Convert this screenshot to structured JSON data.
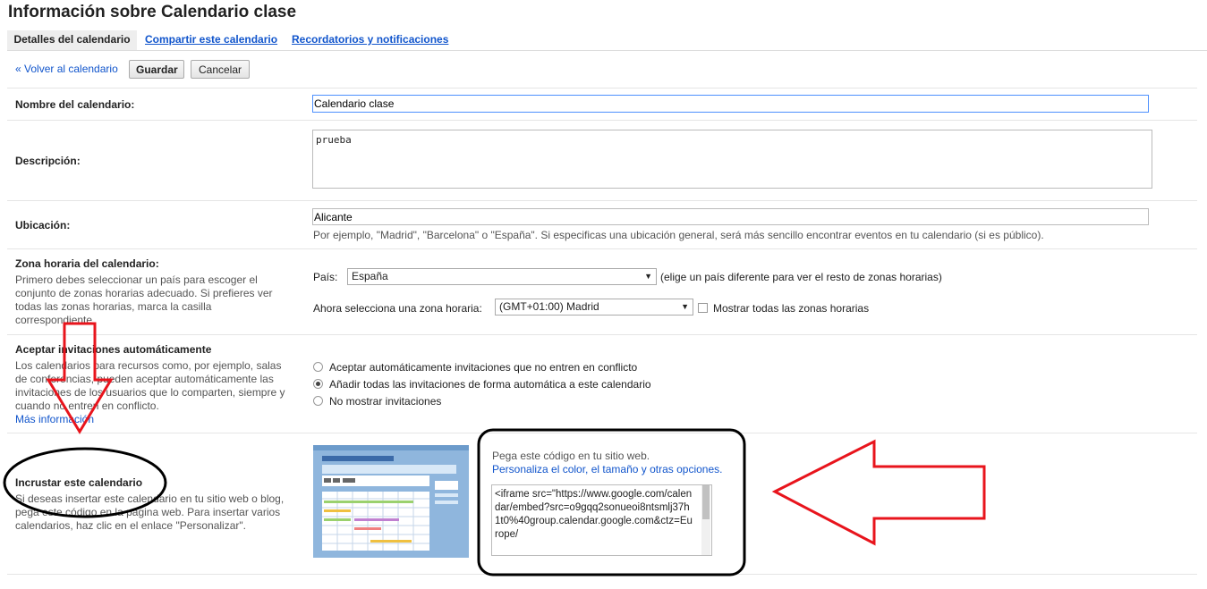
{
  "title": "Información sobre Calendario clase",
  "tabs": [
    "Detalles del calendario",
    "Compartir este calendario",
    "Recordatorios y notificaciones"
  ],
  "toolbar": {
    "back": "« Volver al calendario",
    "save": "Guardar",
    "cancel": "Cancelar"
  },
  "name": {
    "label": "Nombre del calendario:",
    "value": "Calendario clase"
  },
  "description": {
    "label": "Descripción:",
    "value": "prueba"
  },
  "location": {
    "label": "Ubicación:",
    "value": "Alicante",
    "hint": "Por ejemplo, \"Madrid\", \"Barcelona\" o \"España\". Si especificas una ubicación general, será más sencillo encontrar eventos en tu calendario (si es público)."
  },
  "timezone": {
    "label": "Zona horaria del calendario:",
    "desc": [
      "Primero debes seleccionar un país para escoger el",
      "conjunto de zonas horarias adecuado. Si prefieres ver",
      "todas las zonas horarias, marca la casilla",
      "correspondiente."
    ],
    "country_label": "País:",
    "country_value": "España",
    "country_hint": "(elige un país diferente para ver el resto de zonas horarias)",
    "zone_label": "Ahora selecciona una zona horaria:",
    "zone_value": "(GMT+01:00) Madrid",
    "show_all": "Mostrar todas las zonas horarias"
  },
  "invites": {
    "label": "Aceptar invitaciones automáticamente",
    "desc": [
      "Los calendarios para recursos como, por ejemplo, salas",
      "de conferencias, pueden aceptar automáticamente las",
      "invitaciones de los usuarios que lo comparten, siempre y",
      "cuando no entren en conflicto."
    ],
    "more": "Más información",
    "options": [
      "Aceptar automáticamente invitaciones que no entren en conflicto",
      "Añadir todas las invitaciones de forma automática a este calendario",
      "No mostrar invitaciones"
    ],
    "selected": 1
  },
  "embed": {
    "label": "Incrustar este calendario",
    "desc": [
      "Si deseas insertar este calendario en tu sitio web o blog,",
      "pega este código en la página web. Para insertar varios",
      "calendarios, haz clic en el enlace \"Personalizar\"."
    ],
    "paste": "Pega este código en tu sitio web.",
    "customize": "Personaliza el color, el tamaño y otras opciones.",
    "code": "<iframe src=\"https://www.google.com/calendar/embed?src=o9gqq2sonueoi8ntsmlj37h1t0%40group.calendar.google.com&ctz=Europe/"
  },
  "colors": {
    "link": "#1155cc",
    "annotation_red": "#e8141c",
    "tab_bg": "#eeeeee"
  }
}
